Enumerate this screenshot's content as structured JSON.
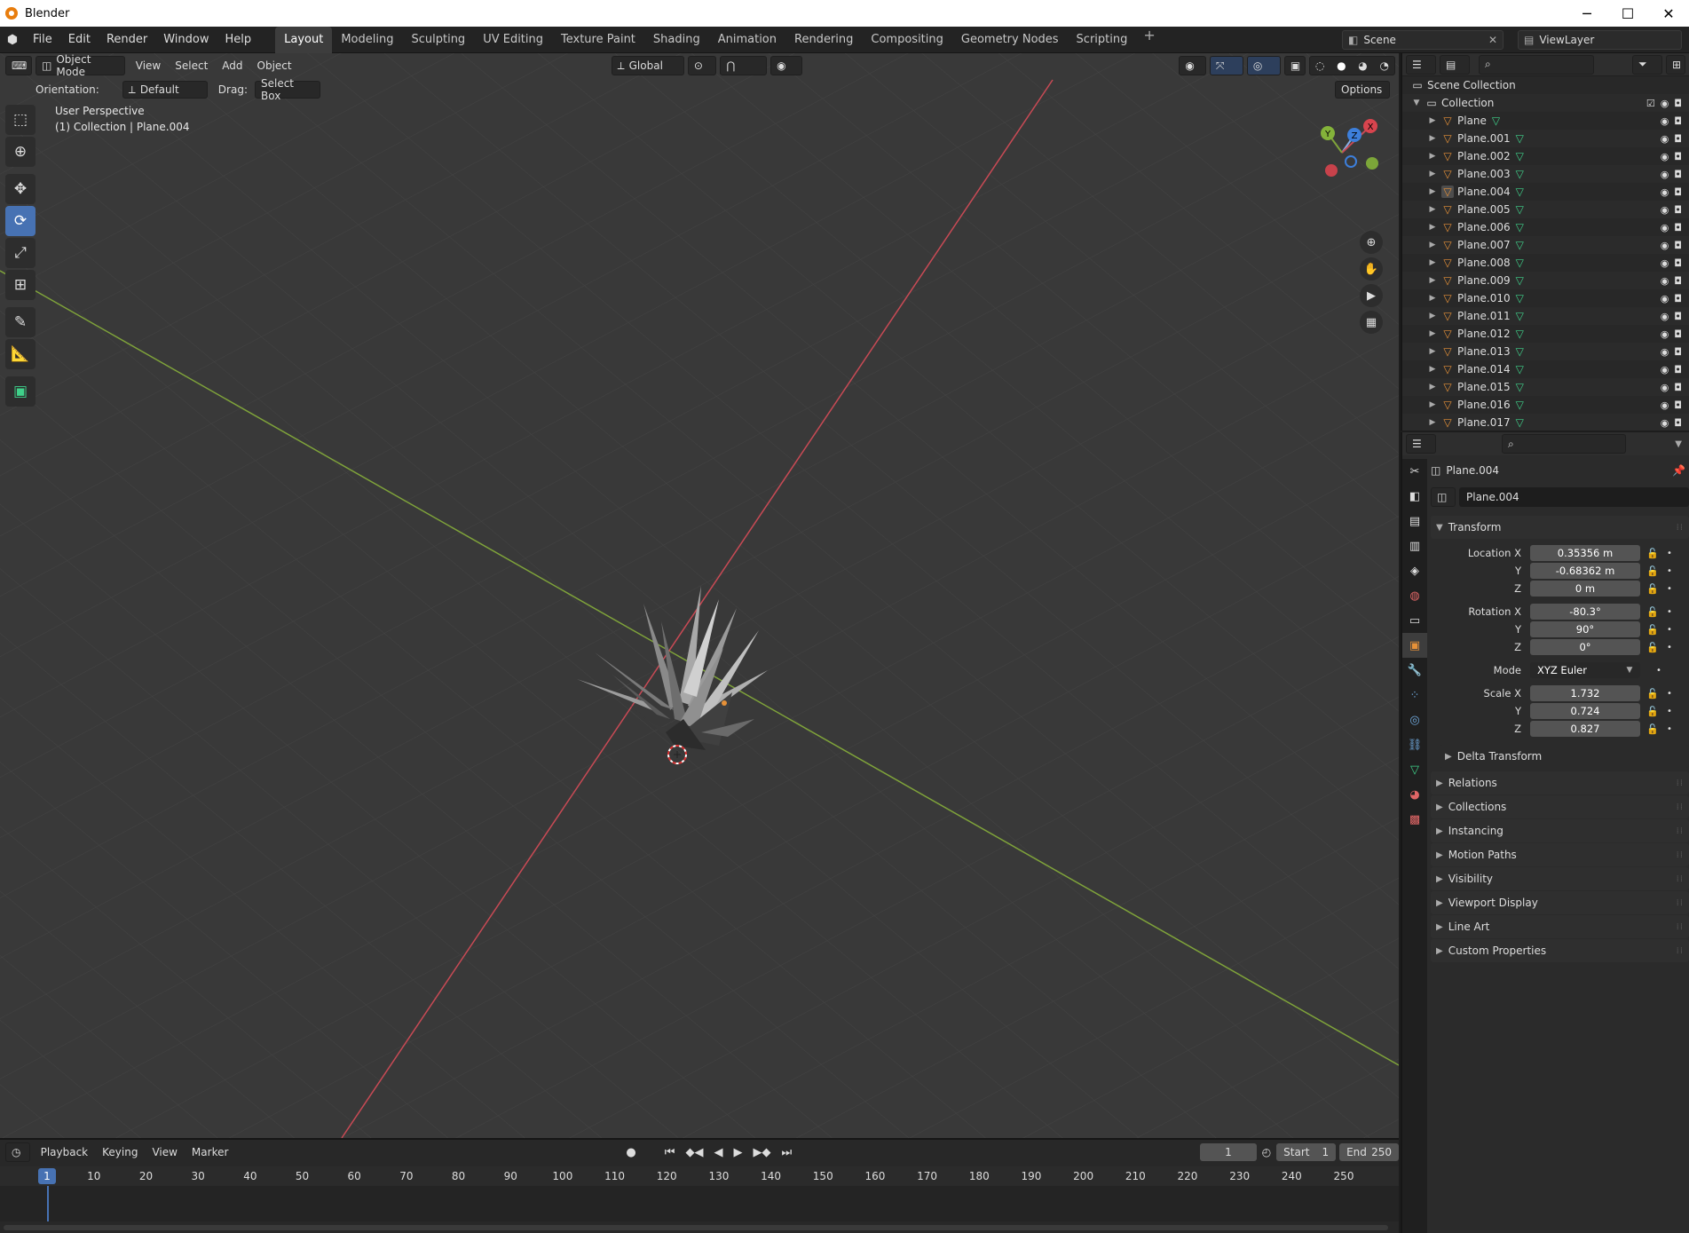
{
  "window": {
    "title": "Blender",
    "minimize": "─",
    "maximize": "☐",
    "close": "✕"
  },
  "menubar": {
    "items": [
      "File",
      "Edit",
      "Render",
      "Window",
      "Help"
    ],
    "workspaces": [
      "Layout",
      "Modeling",
      "Sculpting",
      "UV Editing",
      "Texture Paint",
      "Shading",
      "Animation",
      "Rendering",
      "Compositing",
      "Geometry Nodes",
      "Scripting"
    ],
    "active_workspace": "Layout",
    "add": "+",
    "scene": "Scene",
    "view_layer": "ViewLayer"
  },
  "viewport": {
    "mode": "Object Mode",
    "menus": [
      "View",
      "Select",
      "Add",
      "Object"
    ],
    "transform_orientation": "Global",
    "orientation_label": "Orientation:",
    "orientation_value": "Default",
    "drag_label": "Drag:",
    "drag_value": "Select Box",
    "options": "Options",
    "perspective": "User Perspective",
    "context": "(1) Collection | Plane.004",
    "gizmo": {
      "x": "X",
      "y": "Y",
      "z": "Z"
    }
  },
  "outliner": {
    "scene_collection": "Scene Collection",
    "collection": "Collection",
    "objects": [
      "Plane",
      "Plane.001",
      "Plane.002",
      "Plane.003",
      "Plane.004",
      "Plane.005",
      "Plane.006",
      "Plane.007",
      "Plane.008",
      "Plane.009",
      "Plane.010",
      "Plane.011",
      "Plane.012",
      "Plane.013",
      "Plane.014",
      "Plane.015",
      "Plane.016",
      "Plane.017"
    ],
    "active_object": "Plane.004"
  },
  "properties": {
    "object_name": "Plane.004",
    "object_field": "Plane.004",
    "transform": {
      "title": "Transform",
      "location_label": "Location X",
      "location": [
        "0.35356 m",
        "-0.68362 m",
        "0 m"
      ],
      "rotation_label": "Rotation X",
      "rotation": [
        "-80.3°",
        "90°",
        "0°"
      ],
      "mode_label": "Mode",
      "mode_value": "XYZ Euler",
      "scale_label": "Scale X",
      "scale": [
        "1.732",
        "0.724",
        "0.827"
      ],
      "y_label": "Y",
      "z_label": "Z",
      "delta": "Delta Transform"
    },
    "panels": [
      "Relations",
      "Collections",
      "Instancing",
      "Motion Paths",
      "Visibility",
      "Viewport Display",
      "Line Art",
      "Custom Properties"
    ]
  },
  "timeline": {
    "menus": [
      "Playback",
      "Keying",
      "View",
      "Marker"
    ],
    "current_frame": "1",
    "start_label": "Start",
    "start": "1",
    "end_label": "End",
    "end": "250",
    "ruler": [
      "1",
      "10",
      "20",
      "30",
      "40",
      "50",
      "60",
      "70",
      "80",
      "90",
      "100",
      "110",
      "120",
      "130",
      "140",
      "150",
      "160",
      "170",
      "180",
      "190",
      "200",
      "210",
      "220",
      "230",
      "240",
      "250"
    ]
  },
  "colors": {
    "accent": "#4772b3",
    "object_orange": "#e69138",
    "mesh_green": "#3fd18a",
    "x_axis": "#c84a55",
    "y_axis": "#7fa33a"
  }
}
